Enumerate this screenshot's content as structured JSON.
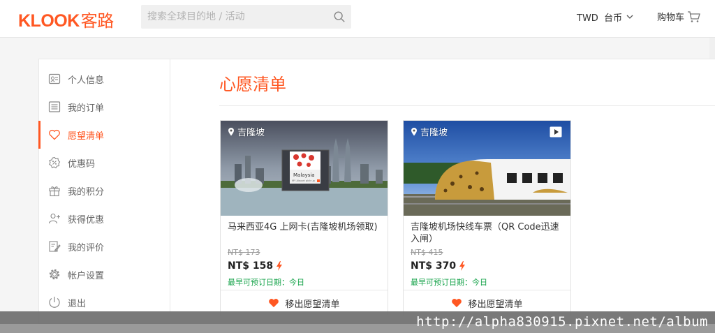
{
  "header": {
    "logo_latin": "KLOOK",
    "logo_cn": "客路",
    "search_placeholder": "搜索全球目的地 / 活动",
    "currency": "TWD  台币",
    "cart": "购物车"
  },
  "sidebar": {
    "items": [
      {
        "label": "个人信息",
        "icon": "id-card-icon"
      },
      {
        "label": "我的订单",
        "icon": "order-list-icon"
      },
      {
        "label": "愿望清单",
        "icon": "heart-icon",
        "active": true
      },
      {
        "label": "优惠码",
        "icon": "coupon-icon"
      },
      {
        "label": "我的积分",
        "icon": "gift-icon"
      },
      {
        "label": "获得优惠",
        "icon": "invite-friends-icon"
      },
      {
        "label": "我的评价",
        "icon": "review-icon"
      },
      {
        "label": "帐户设置",
        "icon": "gear-icon"
      },
      {
        "label": "退出",
        "icon": "power-icon"
      }
    ]
  },
  "main": {
    "title": "心愿清单",
    "cards": [
      {
        "location": "吉隆坡",
        "title": "马来西亚4G 上网卡(吉隆坡机场领取)",
        "original_price": "NT$ 173",
        "price": "NT$ 158",
        "availability": "最早可预订日期：今日",
        "remove_label": "移出愿望清单",
        "sim_text": "Malaysia",
        "sim_subtext": "MY Airport pick up"
      },
      {
        "location": "吉隆坡",
        "title": "吉隆坡机场快线车票（QR Code迅速入闸）",
        "original_price": "NT$ 415",
        "price": "NT$ 370",
        "availability": "最早可预订日期：今日",
        "remove_label": "移出愿望清单"
      }
    ]
  },
  "watermark": "http://alpha830915.pixnet.net/album",
  "colors": {
    "accent": "#ff5722",
    "available": "#16a34a"
  }
}
